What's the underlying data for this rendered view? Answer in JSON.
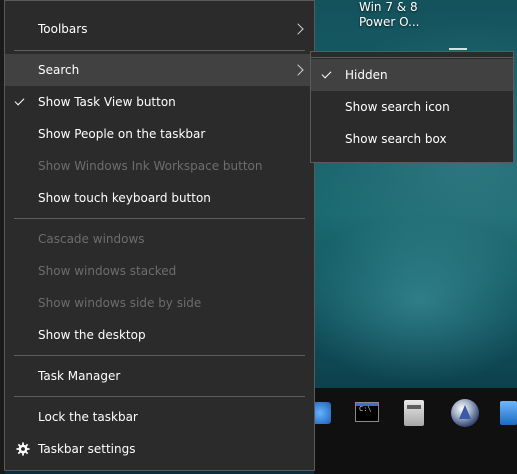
{
  "desktop": {
    "icon_label_line1": "Win 7 & 8",
    "icon_label_line2": "Power O..."
  },
  "taskbar": {
    "icons": [
      "ie-icon",
      "command-prompt-icon",
      "document-icon",
      "globe-icon",
      "computer-icon"
    ],
    "cmd_glyph": "C:\\"
  },
  "context_menu": {
    "toolbars": "Toolbars",
    "search": "Search",
    "show_task_view": "Show Task View button",
    "show_people": "Show People on the taskbar",
    "show_ink": "Show Windows Ink Workspace button",
    "show_touch_keyboard": "Show touch keyboard button",
    "cascade": "Cascade windows",
    "stacked": "Show windows stacked",
    "side_by_side": "Show windows side by side",
    "show_desktop": "Show the desktop",
    "task_manager": "Task Manager",
    "lock_taskbar": "Lock the taskbar",
    "taskbar_settings": "Taskbar settings"
  },
  "search_submenu": {
    "hidden": "Hidden",
    "show_icon": "Show search icon",
    "show_box": "Show search box",
    "selected": "Hidden"
  },
  "colors": {
    "menu_bg": "#2b2b2b",
    "hover_bg": "#414141",
    "disabled_text": "#6d6d6d",
    "text": "#ffffff"
  }
}
